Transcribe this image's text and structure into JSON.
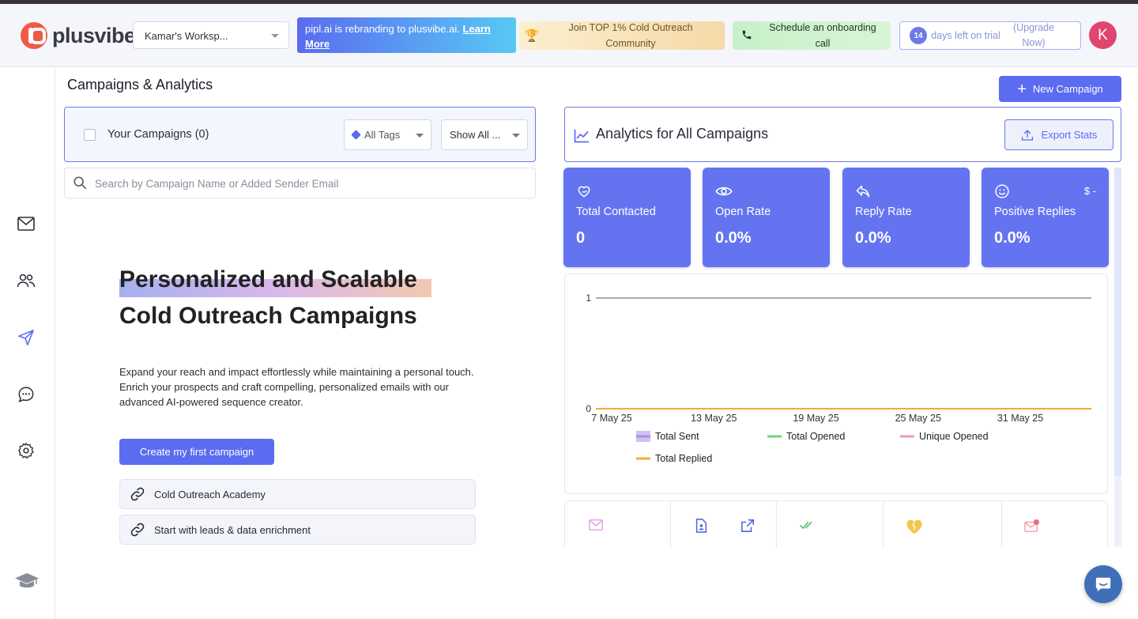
{
  "brand": {
    "name": "plusvibe",
    "color": "#ef5a48"
  },
  "header": {
    "workspace": "Kamar's Worksp...",
    "rebrand": {
      "text": "pipl.ai is rebranding to plusvibe.ai.",
      "link": "Learn More"
    },
    "community": {
      "icon": "trophy-icon",
      "text": "Join TOP 1% Cold Outreach Community"
    },
    "onboarding": {
      "icon": "phone-icon",
      "text": "Schedule an onboarding call"
    },
    "trial": {
      "days": "14",
      "text": "days left on trial",
      "upgrade": "(Upgrade Now)"
    },
    "avatar_initial": "K"
  },
  "sidebar": {
    "items": [
      {
        "name": "inbox",
        "icon": "mail-icon"
      },
      {
        "name": "leads",
        "icon": "users-icon"
      },
      {
        "name": "campaigns",
        "icon": "send-icon"
      },
      {
        "name": "chat",
        "icon": "chat-icon"
      },
      {
        "name": "settings",
        "icon": "gear-icon"
      },
      {
        "name": "academy",
        "icon": "graduation-cap-icon"
      }
    ]
  },
  "page": {
    "title": "Campaigns & Analytics",
    "new_campaign": "New Campaign"
  },
  "campaigns": {
    "label": "Your Campaigns (0)",
    "tags_filter": "All Tags",
    "show_filter": "Show All ...",
    "search_placeholder": "Search by Campaign Name or Added Sender Email"
  },
  "empty_state": {
    "title_line1": "Personalized and Scalable",
    "title_line2": "Cold Outreach Campaigns",
    "description": "Expand your reach and impact effortlessly while maintaining a personal touch. Enrich your prospects and craft compelling, personalized emails with our advanced AI-powered sequence creator.",
    "cta": "Create my first campaign",
    "links": [
      "Cold Outreach Academy",
      "Start with leads & data enrichment"
    ]
  },
  "analytics": {
    "title": "Analytics for All Campaigns",
    "export": "Export Stats",
    "accent": "#6474f1",
    "stats": [
      {
        "label": "Total Contacted",
        "value": "0",
        "icon": "heart-hand-icon"
      },
      {
        "label": "Open Rate",
        "value": "0.0%",
        "icon": "eye-icon"
      },
      {
        "label": "Reply Rate",
        "value": "0.0%",
        "icon": "reply-icon"
      },
      {
        "label": "Positive Replies",
        "value": "0.0%",
        "icon": "smile-icon",
        "extra": "$ -"
      }
    ],
    "bottom_icons": [
      "mail-icon",
      "document-icon",
      "external-link-icon",
      "double-check-icon",
      "broken-heart-icon",
      "mail-alert-icon"
    ]
  },
  "chart_data": {
    "type": "line",
    "x": [
      "7 May 25",
      "13 May 25",
      "19 May 25",
      "25 May 25",
      "31 May 25"
    ],
    "ylim": [
      0,
      1
    ],
    "yticks": [
      "0",
      "1"
    ],
    "series": [
      {
        "name": "Total Sent",
        "color": "#a98ee8",
        "values": [
          0,
          0,
          0,
          0,
          0
        ]
      },
      {
        "name": "Total Opened",
        "color": "#6fd47a",
        "values": [
          0,
          0,
          0,
          0,
          0
        ]
      },
      {
        "name": "Unique Opened",
        "color": "#f29bb0",
        "values": [
          0,
          0,
          0,
          0,
          0
        ]
      },
      {
        "name": "Total Replied",
        "color": "#f5a93a",
        "values": [
          0,
          0,
          0,
          0,
          0
        ]
      }
    ]
  }
}
